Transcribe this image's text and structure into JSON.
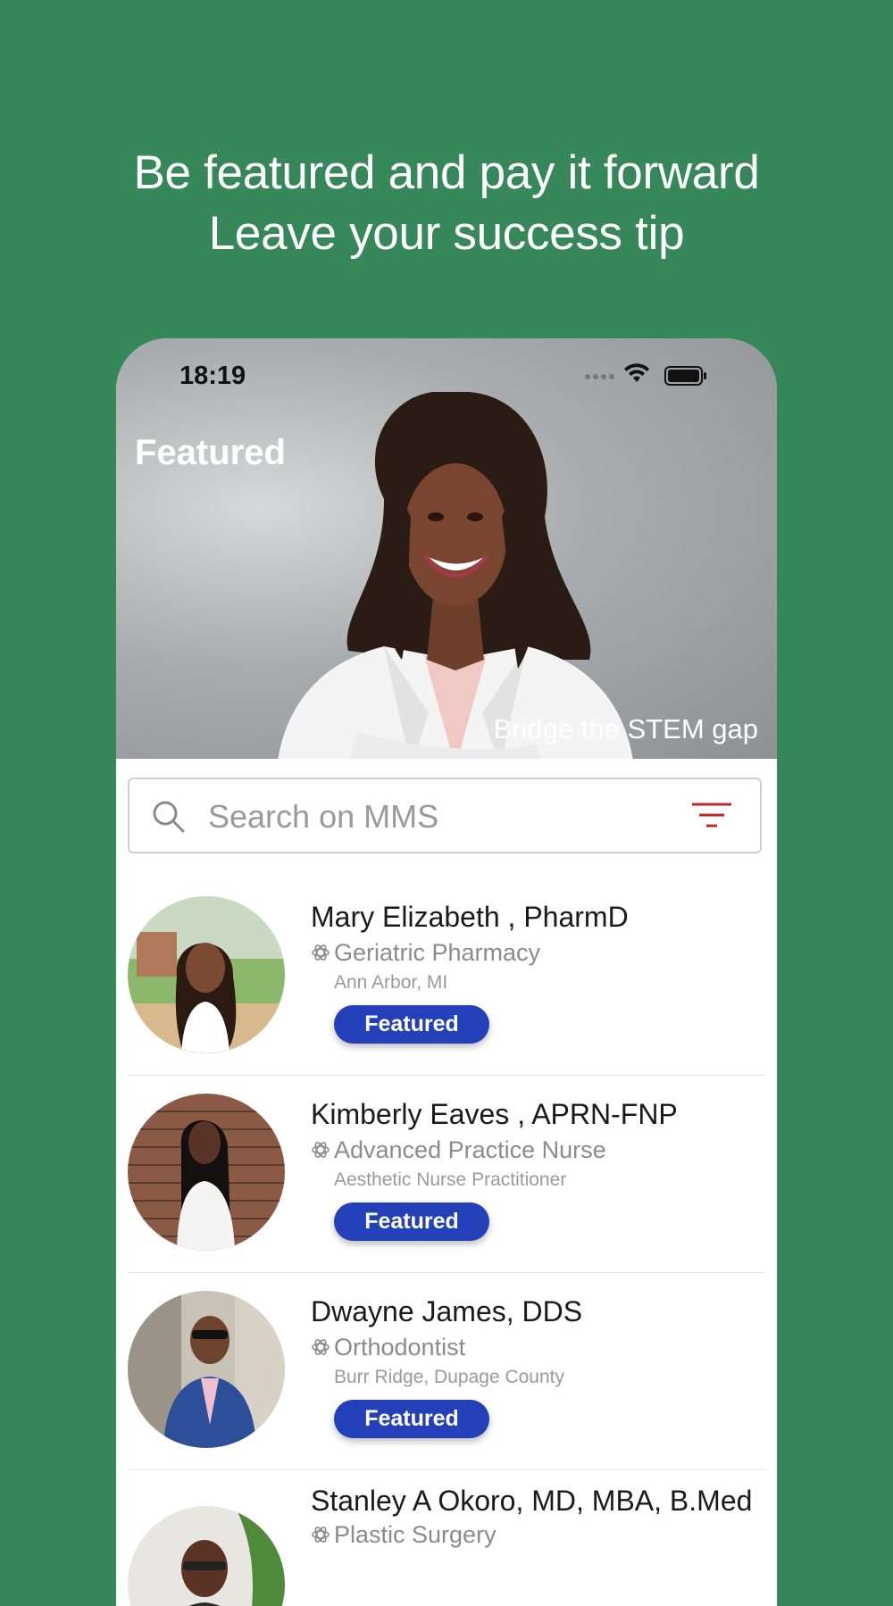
{
  "promo": {
    "line1": "Be featured and pay it forward",
    "line2": "Leave your success tip"
  },
  "status_bar": {
    "time": "18:19",
    "icons": [
      "signal-dots-icon",
      "wifi-icon",
      "battery-icon"
    ]
  },
  "hero": {
    "title": "Featured",
    "caption": "Bridge the STEM gap"
  },
  "search": {
    "placeholder": "Search on MMS",
    "value": ""
  },
  "colors": {
    "background": "#36875A",
    "badge": "#2440B8",
    "filter_icon": "#C0272D"
  },
  "members": [
    {
      "name": "Mary Elizabeth , PharmD",
      "specialty": "Geriatric Pharmacy",
      "location": "Ann Arbor, MI",
      "badge": "Featured"
    },
    {
      "name": "Kimberly Eaves , APRN-FNP",
      "specialty": "Advanced Practice Nurse",
      "location": "Aesthetic Nurse Practitioner",
      "badge": "Featured"
    },
    {
      "name": "Dwayne James, DDS",
      "specialty": "Orthodontist",
      "location": "Burr Ridge, Dupage County",
      "badge": "Featured"
    },
    {
      "name": "Stanley A Okoro, MD, MBA, B.Med",
      "specialty": "Plastic Surgery",
      "location": "",
      "badge": ""
    }
  ]
}
